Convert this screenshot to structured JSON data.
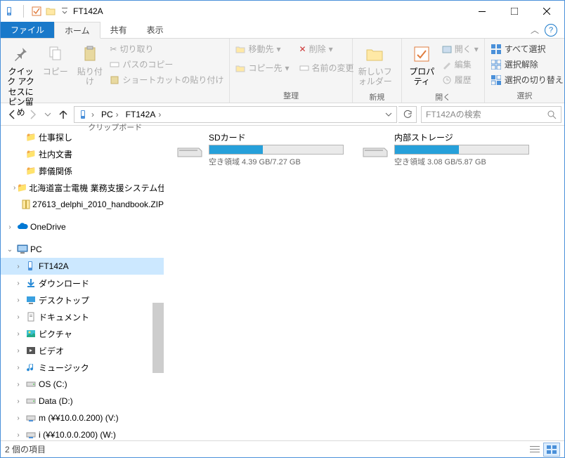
{
  "window": {
    "title": "FT142A"
  },
  "tabs": {
    "file": "ファイル",
    "home": "ホーム",
    "share": "共有",
    "view": "表示"
  },
  "ribbon": {
    "pin": "クイック アクセスにピン留め",
    "copy": "コピー",
    "paste": "貼り付け",
    "cut": "切り取り",
    "copypath": "パスのコピー",
    "pasteshortcut": "ショートカットの貼り付け",
    "clipboard": "クリップボード",
    "moveto": "移動先",
    "copyto": "コピー先",
    "delete": "削除",
    "rename": "名前の変更",
    "organize": "整理",
    "newfolder": "新しいフォルダー",
    "new": "新規",
    "properties": "プロパティ",
    "open": "開く",
    "edit": "編集",
    "history": "履歴",
    "openg": "開く",
    "selectall": "すべて選択",
    "selectnone": "選択解除",
    "invert": "選択の切り替え",
    "select": "選択"
  },
  "breadcrumb": {
    "pc": "PC",
    "loc": "FT142A"
  },
  "search": {
    "placeholder": "FT142Aの検索"
  },
  "tree": {
    "q1": "仕事探し",
    "q2": "社内文書",
    "q3": "葬儀関係",
    "q4": "北海道富士電機 業務支援システム仕",
    "q5": "27613_delphi_2010_handbook.ZIP",
    "onedrive": "OneDrive",
    "pc": "PC",
    "p1": "FT142A",
    "p2": "ダウンロード",
    "p3": "デスクトップ",
    "p4": "ドキュメント",
    "p5": "ピクチャ",
    "p6": "ビデオ",
    "p7": "ミュージック",
    "p8": "OS (C:)",
    "p9": "Data (D:)",
    "p10": "m (¥¥10.0.0.200) (V:)",
    "p11": "i (¥¥10.0.0.200) (W:)"
  },
  "tiles": {
    "sd": {
      "name": "SDカード",
      "sub": "空き領域 4.39 GB/7.27 GB",
      "pct": 40
    },
    "internal": {
      "name": "内部ストレージ",
      "sub": "空き領域 3.08 GB/5.87 GB",
      "pct": 48
    }
  },
  "status": {
    "items": "2 個の項目"
  }
}
